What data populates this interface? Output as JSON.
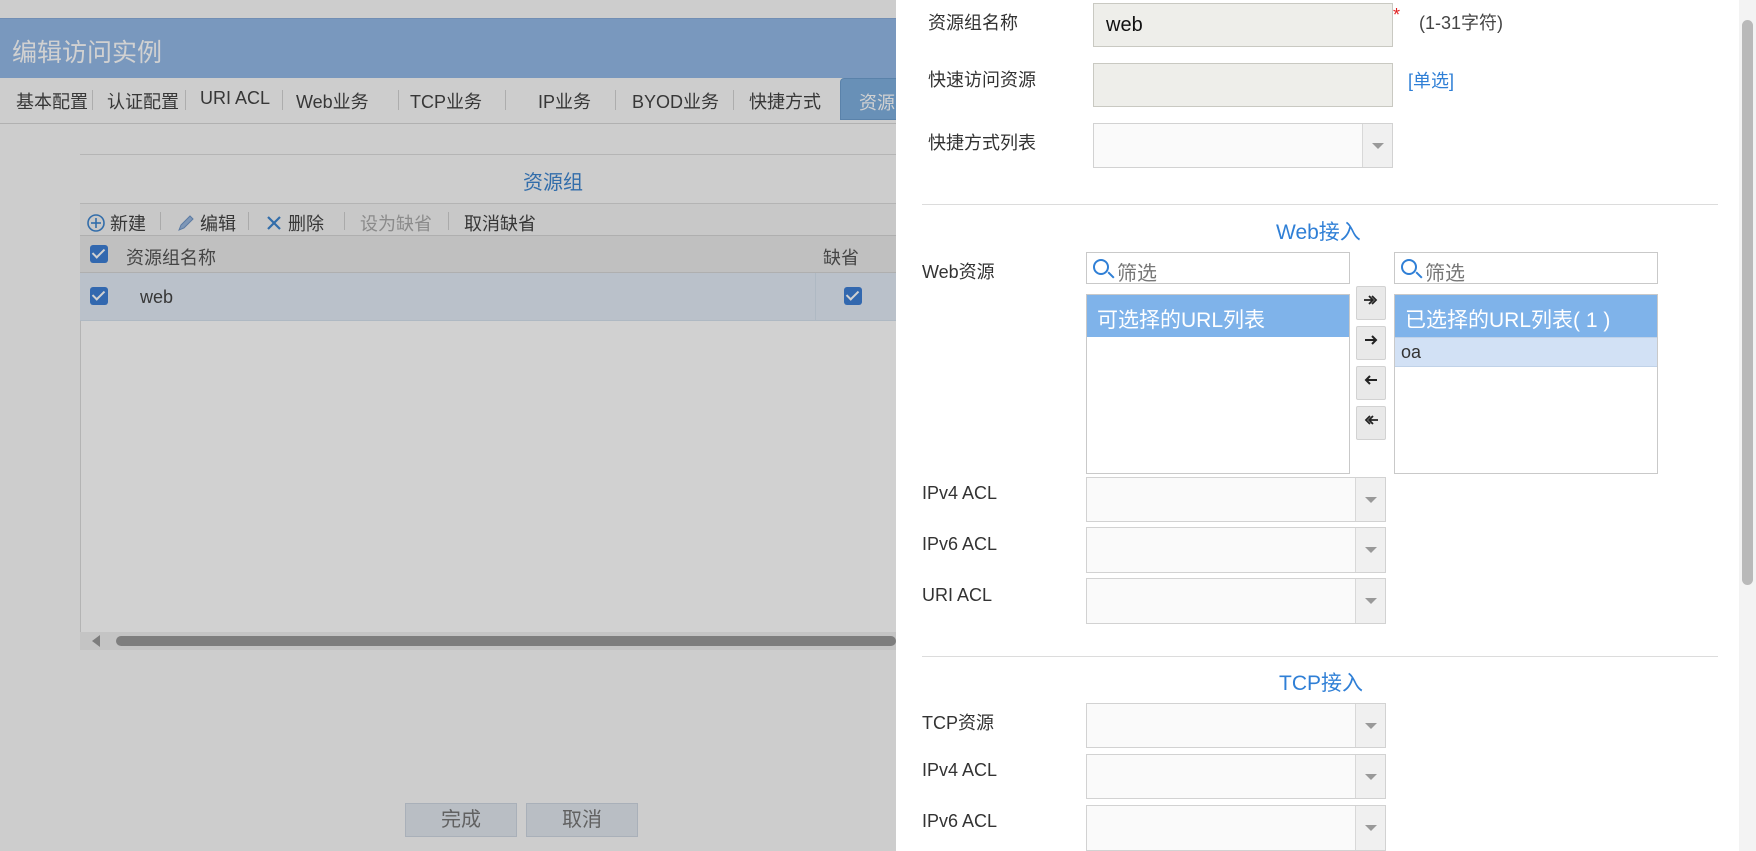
{
  "background_dialog": {
    "title": "编辑访问实例",
    "tabs": [
      "基本配置",
      "认证配置",
      "URI ACL",
      "Web业务",
      "TCP业务",
      "IP业务",
      "BYOD业务",
      "快捷方式"
    ],
    "active_tab": "资源",
    "section_title": "资源组",
    "toolbar": {
      "new": "新建",
      "edit": "编辑",
      "delete": "删除",
      "set_default": "设为缺省",
      "cancel_default": "取消缺省"
    },
    "grid": {
      "columns": [
        "资源组名称",
        "缺省"
      ],
      "rows": [
        {
          "name": "web",
          "selected": true,
          "default": true
        }
      ]
    },
    "buttons": {
      "finish": "完成",
      "cancel": "取消"
    }
  },
  "panel": {
    "group_name_label": "资源组名称",
    "group_name_value": "web",
    "required_mark": "*",
    "group_name_hint": "(1-31字符)",
    "quick_access_label": "快速访问资源",
    "quick_access_value": "",
    "quick_access_link": "[单选]",
    "shortcut_list_label": "快捷方式列表",
    "web_section": {
      "title": "Web接入",
      "resource_label": "Web资源",
      "filter_placeholder": "筛选",
      "available_header": "可选择的URL列表",
      "selected_header": "已选择的URL列表( 1 )",
      "selected_items": [
        "oa"
      ],
      "move_buttons": [
        "move-all-right",
        "move-right",
        "move-left",
        "move-all-left"
      ],
      "ipv4_acl_label": "IPv4 ACL",
      "ipv6_acl_label": "IPv6 ACL",
      "uri_acl_label": "URI ACL"
    },
    "tcp_section": {
      "title": "TCP接入",
      "resource_label": "TCP资源",
      "ipv4_acl_label": "IPv4 ACL",
      "ipv6_acl_label": "IPv6 ACL"
    }
  },
  "colors": {
    "accent": "#2f7fd6",
    "title_bar": "#94bae8",
    "list_header": "#7fb3ea",
    "selected_item": "#d2e1f5",
    "required": "#e02020"
  }
}
